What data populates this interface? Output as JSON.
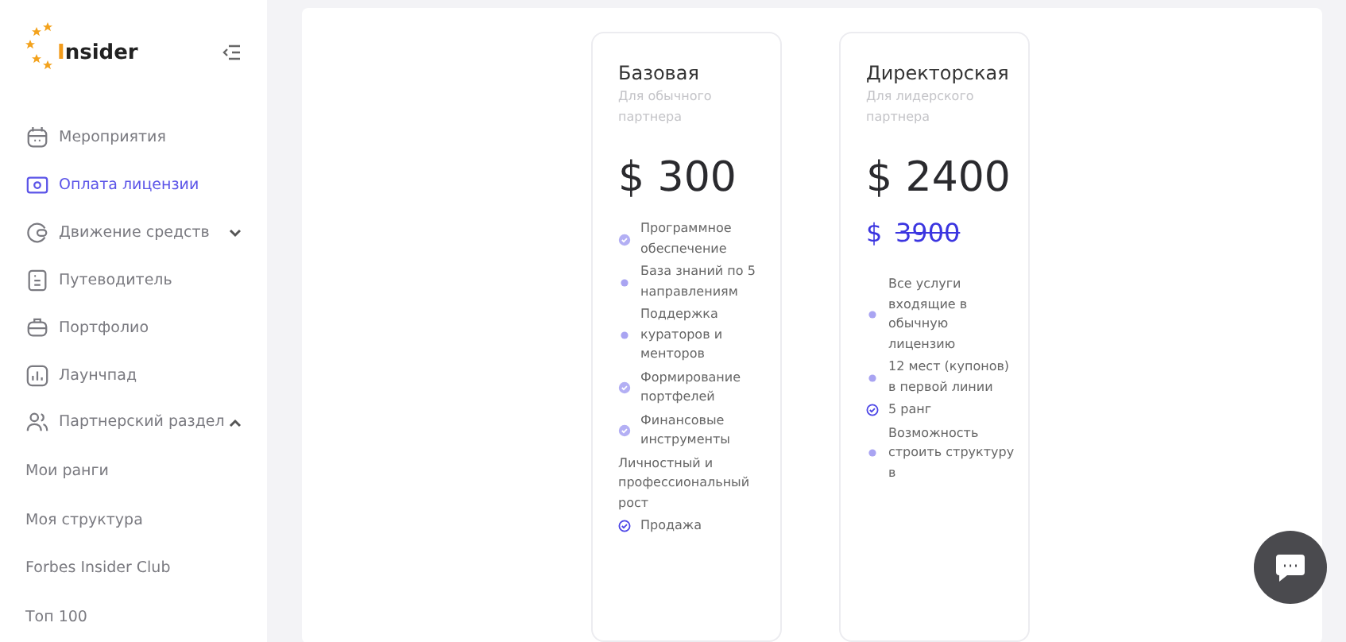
{
  "sidebar": {
    "logo": "Insider",
    "items": [
      {
        "label": "Мероприятия",
        "selected": false
      },
      {
        "label": "Оплата лицензии",
        "selected": true
      },
      {
        "label": "Движение средств",
        "selected": false,
        "expanded": false
      },
      {
        "label": "Путеводитель",
        "selected": false
      },
      {
        "label": "Портфолио",
        "selected": false
      },
      {
        "label": "Лаунчпад",
        "selected": false
      },
      {
        "label": "Партнерский раздел",
        "selected": false,
        "expanded": true,
        "children": [
          {
            "label": "Мои ранги"
          },
          {
            "label": "Моя структура"
          },
          {
            "label": "Forbes Insider Club"
          },
          {
            "label": "Топ 100"
          }
        ]
      }
    ]
  },
  "plans": [
    {
      "name": "Базовая",
      "subtitle": "Для обычного партнера",
      "currency": "$",
      "price": "300",
      "features": [
        {
          "text": "Программное обеспечение",
          "kind": "check"
        },
        {
          "text": "База знаний по 5 направлениям",
          "kind": "dot"
        },
        {
          "text": "Поддержка кураторов и менторов",
          "kind": "dot"
        },
        {
          "text": "Формирование портфелей",
          "kind": "check"
        },
        {
          "text": "Финансовые инструменты",
          "kind": "check"
        },
        {
          "text": "Личностный и профессиональный рост",
          "kind": "plain"
        },
        {
          "text": "Продажа",
          "kind": "ring"
        }
      ]
    },
    {
      "name": "Директорская",
      "subtitle": "Для лидерского партнера",
      "currency": "$",
      "price": "2400",
      "old_currency": "$",
      "old_price": "3900",
      "features": [
        {
          "text": "Все услуги входящие в обычную лицензию",
          "kind": "dot"
        },
        {
          "text": "12 мест (купонов) в первой линии",
          "kind": "dot"
        },
        {
          "text": "5 ранг",
          "kind": "ring"
        },
        {
          "text": "Возможность строить структуру в",
          "kind": "dot"
        }
      ]
    }
  ]
}
